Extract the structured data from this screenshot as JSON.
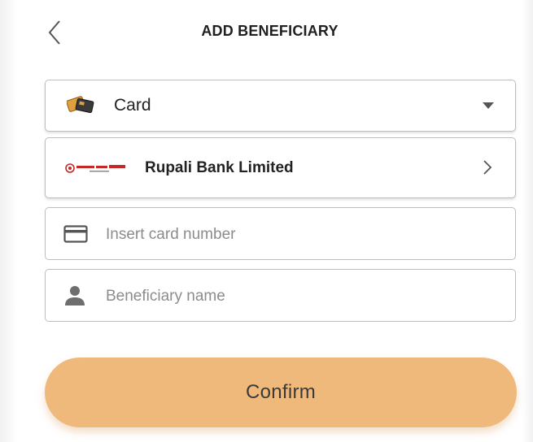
{
  "header": {
    "title": "ADD BENEFICIARY",
    "back_icon": "chevron-left-icon"
  },
  "type_select": {
    "icon": "card-icon",
    "selected_value": "Card",
    "arrow_icon": "caret-down-icon"
  },
  "bank_select": {
    "logo": "rupali-bank-logo",
    "value": "Rupali Bank Limited",
    "arrow_icon": "chevron-right-icon"
  },
  "card_number": {
    "icon": "credit-card-icon",
    "placeholder": "Insert card number",
    "value": ""
  },
  "beneficiary_name": {
    "icon": "person-icon",
    "placeholder": "Beneficiary name",
    "value": ""
  },
  "confirm": {
    "label": "Confirm"
  },
  "colors": {
    "accent": "#f0b97c",
    "border": "#bdbdbd",
    "text": "#222222",
    "placeholder": "#8c8c8c"
  }
}
